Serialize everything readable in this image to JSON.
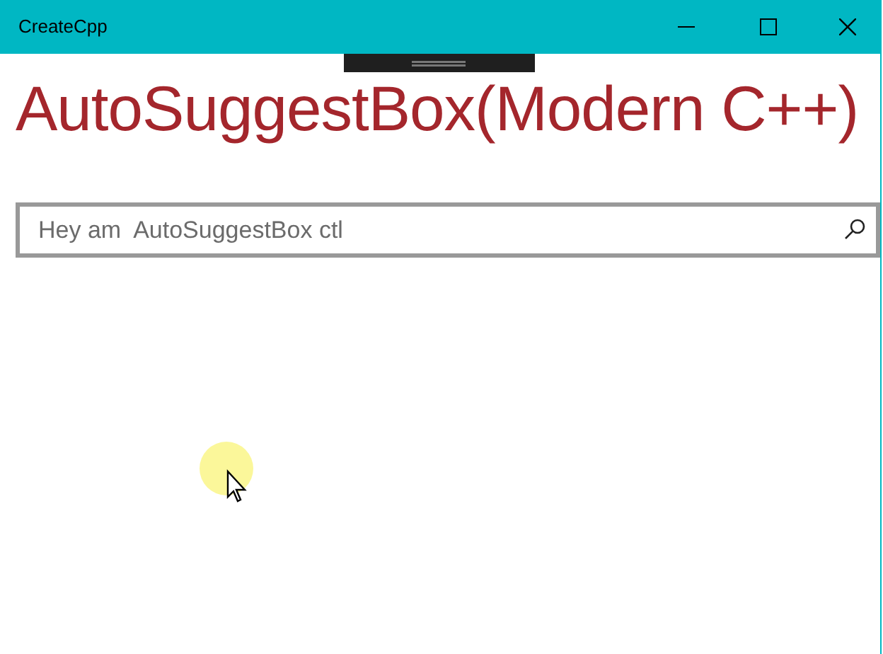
{
  "window": {
    "title": "CreateCpp"
  },
  "heading": "AutoSuggestBox(Modern C++)",
  "search": {
    "placeholder": "Hey am  AutoSuggestBox ctl"
  }
}
